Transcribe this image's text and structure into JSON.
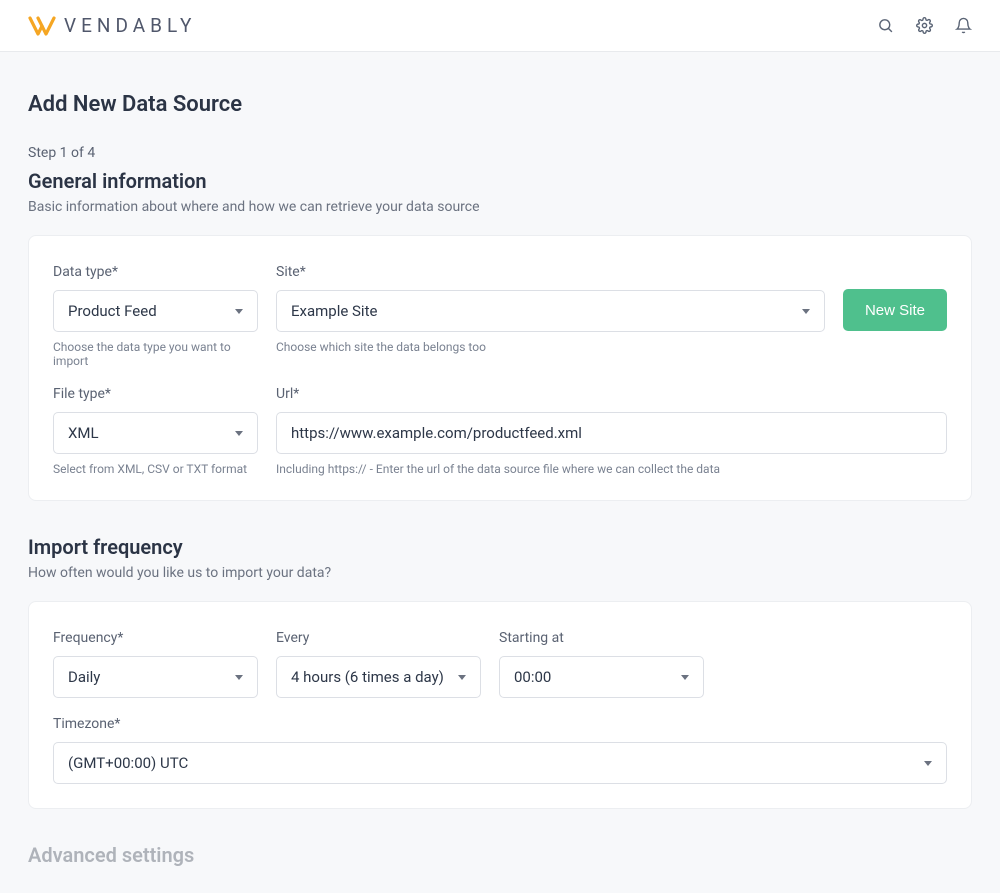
{
  "brand": "VENDABLY",
  "page_title": "Add New Data Source",
  "step_label": "Step 1 of 4",
  "sections": {
    "general": {
      "title": "General information",
      "desc": "Basic information about where and how we can retrieve your data source",
      "data_type": {
        "label": "Data type*",
        "value": "Product Feed",
        "help": "Choose the data type you want to import"
      },
      "site": {
        "label": "Site*",
        "value": "Example Site",
        "help": "Choose which site the data belongs too"
      },
      "new_site_btn": "New Site",
      "file_type": {
        "label": "File type*",
        "value": "XML",
        "help": "Select from XML, CSV or TXT format"
      },
      "url": {
        "label": "Url*",
        "value": "https://www.example.com/productfeed.xml",
        "help": "Including https:// - Enter the url of the data source file where we can collect the data"
      }
    },
    "frequency": {
      "title": "Import frequency",
      "desc": "How often would you like us to import your data?",
      "freq": {
        "label": "Frequency*",
        "value": "Daily"
      },
      "every": {
        "label": "Every",
        "value": "4 hours (6 times a day)"
      },
      "starting": {
        "label": "Starting at",
        "value": "00:00"
      },
      "timezone": {
        "label": "Timezone*",
        "value": "(GMT+00:00) UTC"
      }
    },
    "advanced": {
      "title": "Advanced settings"
    }
  }
}
